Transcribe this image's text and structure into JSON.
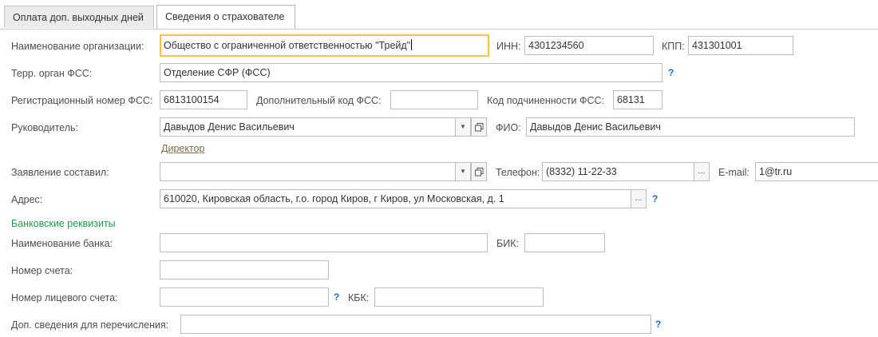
{
  "tabs": [
    {
      "label": "Оплата доп. выходных дней"
    },
    {
      "label": "Сведения о страхователе"
    }
  ],
  "org": {
    "label": "Наименование организации:",
    "value": "Общество с ограниченной ответственностью \"Трейд\""
  },
  "inn": {
    "label": "ИНН:",
    "value": "4301234560"
  },
  "kpp": {
    "label": "КПП:",
    "value": "431301001"
  },
  "fss_org": {
    "label": "Терр. орган ФСС:",
    "value": "Отделение СФР (ФСС)",
    "help": "?"
  },
  "reg_num": {
    "label": "Регистрационный номер ФСС:",
    "value": "6813100154"
  },
  "add_code": {
    "label": "Дополнительный код ФСС:",
    "value": ""
  },
  "sub_code": {
    "label": "Код подчиненности ФСС:",
    "value": "68131"
  },
  "head": {
    "label": "Руководитель:",
    "value": "Давыдов Денис Васильевич",
    "position_link": "Директор"
  },
  "fio": {
    "label": "ФИО:",
    "value": "Давыдов Денис Васильевич"
  },
  "compiler": {
    "label": "Заявление составил:",
    "value": ""
  },
  "phone": {
    "label": "Телефон:",
    "value": "(8332) 11-22-33"
  },
  "email": {
    "label": "E-mail:",
    "value": "1@tr.ru"
  },
  "address": {
    "label": "Адрес:",
    "value": "610020, Кировская область, г.о. город Киров, г Киров, ул Московская, д. 1",
    "help": "?"
  },
  "bank": {
    "section_title": "Банковские реквизиты",
    "name_label": "Наименование банка:",
    "name_value": "",
    "bik_label": "БИК:",
    "bik_value": "",
    "account_label": "Номер счета:",
    "account_value": "",
    "personal_label": "Номер лицевого счета:",
    "personal_value": "",
    "personal_help": "?",
    "kbk_label": "КБК:",
    "kbk_value": ""
  },
  "extra": {
    "label": "Доп. сведения для перечисления:",
    "value": "",
    "help": "?"
  },
  "buttons": {
    "ellipsis": "...",
    "dropdown": "▼"
  }
}
